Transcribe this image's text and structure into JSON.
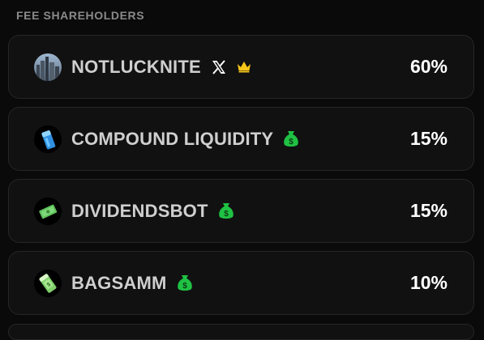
{
  "section": {
    "title": "FEE SHAREHOLDERS"
  },
  "shareholders": [
    {
      "name": "NOTLUCKNITE",
      "share": "60%",
      "badges": [
        "x-logo-icon",
        "crown-icon"
      ]
    },
    {
      "name": "COMPOUND LIQUIDITY",
      "share": "15%",
      "badges": [
        "money-bag-icon"
      ]
    },
    {
      "name": "DIVIDENDSBOT",
      "share": "15%",
      "badges": [
        "money-bag-icon"
      ]
    },
    {
      "name": "BAGSAMM",
      "share": "10%",
      "badges": [
        "money-bag-icon"
      ]
    }
  ],
  "colors": {
    "background": "#0a0a0a",
    "card": "#111111",
    "crown": "#f5c518",
    "money_bag": "#1fc243"
  }
}
